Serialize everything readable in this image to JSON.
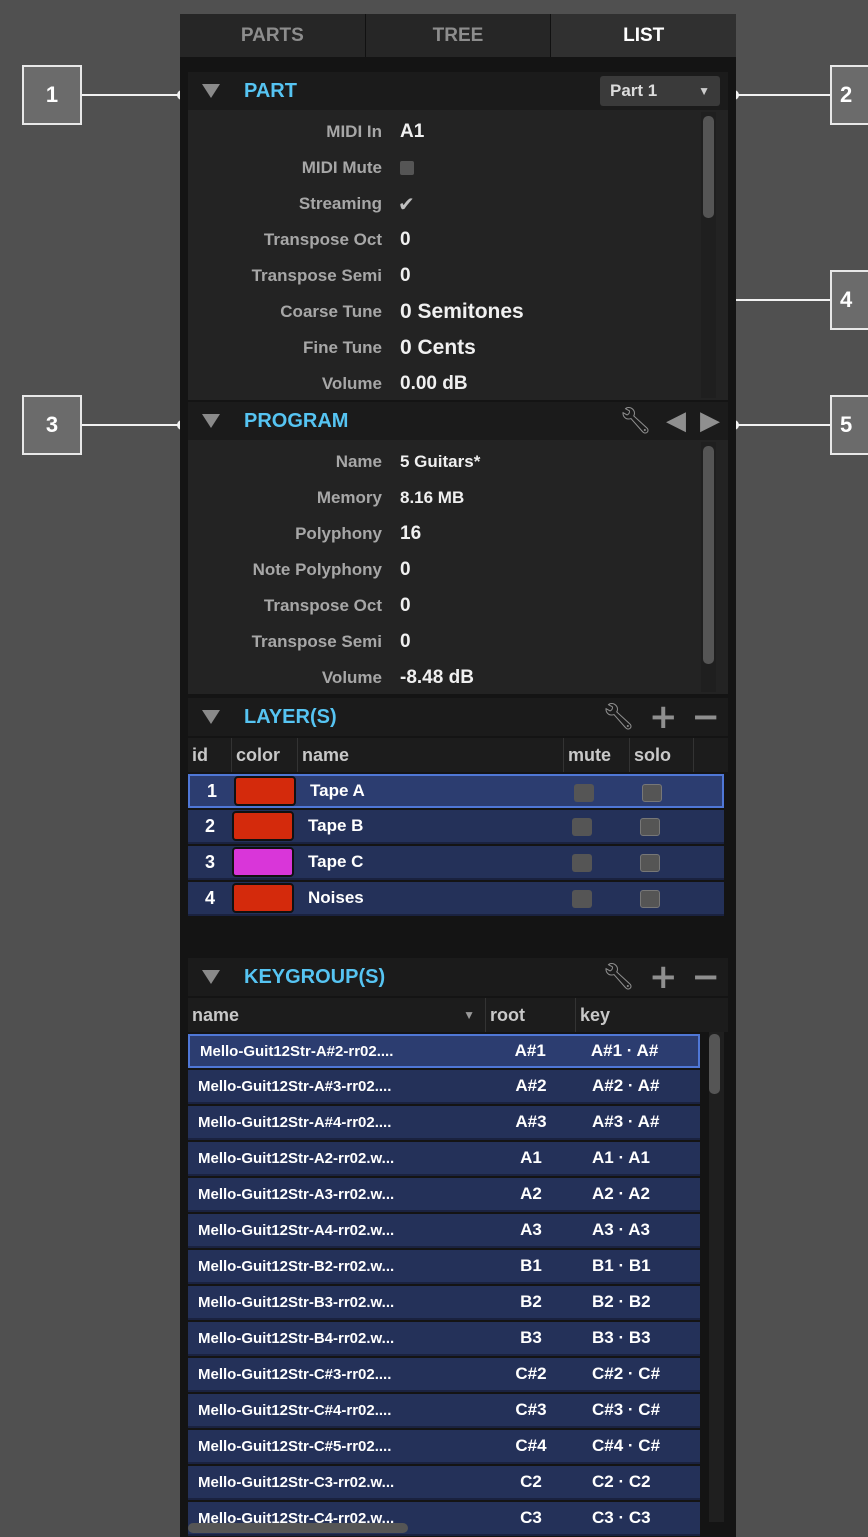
{
  "callouts": [
    "1",
    "2",
    "3",
    "4",
    "5"
  ],
  "tabs": [
    {
      "label": "PARTS"
    },
    {
      "label": "TREE"
    },
    {
      "label": "LIST"
    }
  ],
  "part": {
    "title": "PART",
    "selector": "Part 1",
    "props": [
      {
        "label": "MIDI In",
        "value": "A1"
      },
      {
        "label": "MIDI Mute",
        "value": ""
      },
      {
        "label": "Streaming",
        "value": "✔"
      },
      {
        "label": "Transpose Oct",
        "value": "0"
      },
      {
        "label": "Transpose Semi",
        "value": "0"
      },
      {
        "label": "Coarse Tune",
        "value": "0 Semitones"
      },
      {
        "label": "Fine Tune",
        "value": "0 Cents"
      },
      {
        "label": "Volume",
        "value": "0.00 dB"
      }
    ]
  },
  "program": {
    "title": "PROGRAM",
    "props": [
      {
        "label": "Name",
        "value": "5 Guitars*"
      },
      {
        "label": "Memory",
        "value": "8.16 MB"
      },
      {
        "label": "Polyphony",
        "value": "16"
      },
      {
        "label": "Note Polyphony",
        "value": "0"
      },
      {
        "label": "Transpose Oct",
        "value": "0"
      },
      {
        "label": "Transpose Semi",
        "value": "0"
      },
      {
        "label": "Volume",
        "value": "-8.48 dB"
      }
    ]
  },
  "layers": {
    "title": "LAYER(S)",
    "columns": [
      "id",
      "color",
      "name",
      "mute",
      "solo"
    ],
    "rows": [
      {
        "id": "1",
        "color": "#d42a0c",
        "name": "Tape A"
      },
      {
        "id": "2",
        "color": "#d42a0c",
        "name": "Tape B"
      },
      {
        "id": "3",
        "color": "#d936d9",
        "name": "Tape C"
      },
      {
        "id": "4",
        "color": "#d42a0c",
        "name": "Noises"
      }
    ]
  },
  "keygroups": {
    "title": "KEYGROUP(S)",
    "columns": [
      "name",
      "root",
      "key"
    ],
    "rows": [
      {
        "name": "Mello-Guit12Str-A#2-rr02....",
        "root": "A#1",
        "key": "A#1  ·  A#"
      },
      {
        "name": "Mello-Guit12Str-A#3-rr02....",
        "root": "A#2",
        "key": "A#2  ·  A#"
      },
      {
        "name": "Mello-Guit12Str-A#4-rr02....",
        "root": "A#3",
        "key": "A#3  ·  A#"
      },
      {
        "name": "Mello-Guit12Str-A2-rr02.w...",
        "root": "A1",
        "key": "A1  ·  A1"
      },
      {
        "name": "Mello-Guit12Str-A3-rr02.w...",
        "root": "A2",
        "key": "A2  ·  A2"
      },
      {
        "name": "Mello-Guit12Str-A4-rr02.w...",
        "root": "A3",
        "key": "A3  ·  A3"
      },
      {
        "name": "Mello-Guit12Str-B2-rr02.w...",
        "root": "B1",
        "key": "B1  ·  B1"
      },
      {
        "name": "Mello-Guit12Str-B3-rr02.w...",
        "root": "B2",
        "key": "B2  ·  B2"
      },
      {
        "name": "Mello-Guit12Str-B4-rr02.w...",
        "root": "B3",
        "key": "B3  ·  B3"
      },
      {
        "name": "Mello-Guit12Str-C#3-rr02....",
        "root": "C#2",
        "key": "C#2  ·  C#"
      },
      {
        "name": "Mello-Guit12Str-C#4-rr02....",
        "root": "C#3",
        "key": "C#3  ·  C#"
      },
      {
        "name": "Mello-Guit12Str-C#5-rr02....",
        "root": "C#4",
        "key": "C#4  ·  C#"
      },
      {
        "name": "Mello-Guit12Str-C3-rr02.w...",
        "root": "C2",
        "key": "C2  ·  C2"
      },
      {
        "name": "Mello-Guit12Str-C4-rr02.w...",
        "root": "C3",
        "key": "C3  ·  C3"
      }
    ]
  }
}
